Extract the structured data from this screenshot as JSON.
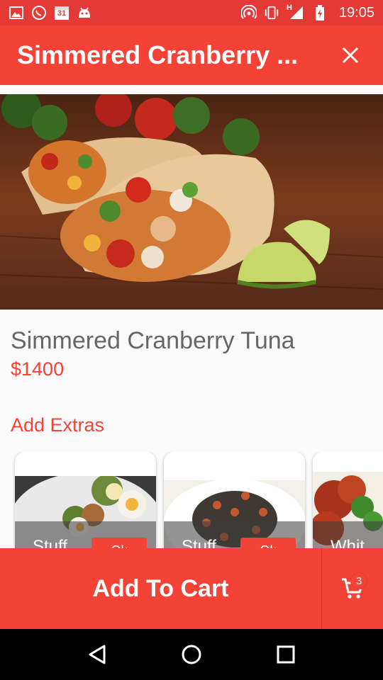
{
  "status_bar": {
    "time": "19:05",
    "calendar_day": "31",
    "network_type": "H",
    "icons": [
      "image-icon",
      "whatsapp-icon",
      "calendar-icon",
      "android-icon",
      "hotspot-icon",
      "vibrate-icon",
      "signal-icon",
      "battery-charging-icon"
    ]
  },
  "app_bar": {
    "title": "Simmered Cranberry ...",
    "close_icon": "close-icon"
  },
  "dish": {
    "name": "Simmered Cranberry Tuna",
    "price": "$1400"
  },
  "extras": {
    "title": "Add Extras",
    "items": [
      {
        "label": "Stuff",
        "button": "Ok"
      },
      {
        "label": "Stuff",
        "button": "Ok"
      },
      {
        "label": "Whit",
        "button": ""
      }
    ]
  },
  "cart": {
    "add_label": "Add To Cart",
    "count": "3",
    "icon": "cart-icon"
  },
  "colors": {
    "accent": "#f44336",
    "status_bar": "#e53935",
    "price_text": "#f44336",
    "name_text": "#666666"
  },
  "nav": {
    "icons": [
      "back-icon",
      "home-icon",
      "recents-icon"
    ]
  }
}
